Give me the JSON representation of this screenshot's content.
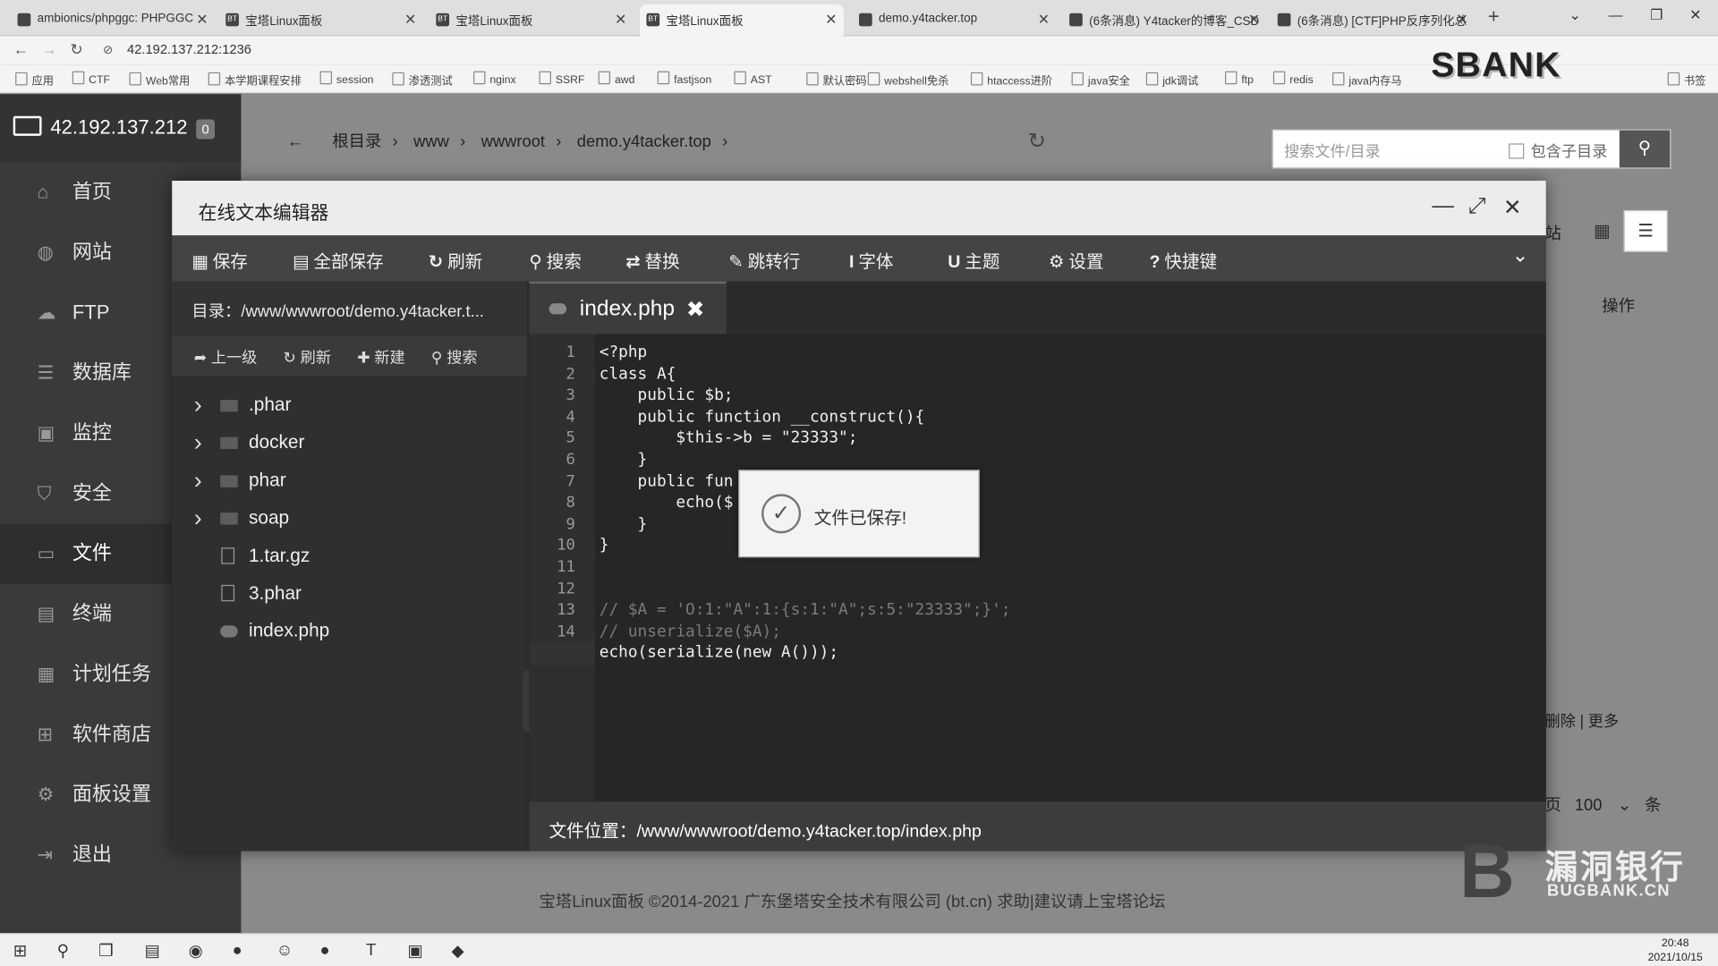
{
  "browser": {
    "tabs": [
      {
        "label": "ambionics/phpggc: PHPGGC",
        "favicon": "github-icon"
      },
      {
        "label": "宝塔Linux面板",
        "favicon": "bt-icon"
      },
      {
        "label": "宝塔Linux面板",
        "favicon": "bt-icon"
      },
      {
        "label": "宝塔Linux面板",
        "favicon": "bt-icon"
      },
      {
        "label": "demo.y4tacker.top",
        "favicon": "globe-icon"
      },
      {
        "label": "(6条消息) Y4tacker的博客_CSD",
        "favicon": "csdn-icon"
      },
      {
        "label": "(6条消息) [CTF]PHP反序列化总",
        "favicon": "csdn-icon"
      }
    ],
    "url": "42.192.137.212:1236",
    "bookmarks": [
      "应用",
      "CTF",
      "Web常用",
      "本学期课程安排",
      "session",
      "渗透测试",
      "nginx",
      "SSRF",
      "awd",
      "fastjson",
      "AST",
      "默认密码",
      "webshell免杀",
      "htaccess进阶",
      "java安全",
      "jdk调试",
      "ftp",
      "redis",
      "java内存马",
      "书签"
    ]
  },
  "overlay_logo": "SBANK",
  "sidebar": {
    "host": "42.192.137.212",
    "badge": "0",
    "items": [
      {
        "label": "首页",
        "icon": "home-icon"
      },
      {
        "label": "网站",
        "icon": "globe-icon"
      },
      {
        "label": "FTP",
        "icon": "ftp-icon"
      },
      {
        "label": "数据库",
        "icon": "database-icon"
      },
      {
        "label": "监控",
        "icon": "monitor-icon"
      },
      {
        "label": "安全",
        "icon": "shield-icon"
      },
      {
        "label": "文件",
        "icon": "folder-icon"
      },
      {
        "label": "终端",
        "icon": "terminal-icon"
      },
      {
        "label": "计划任务",
        "icon": "calendar-icon"
      },
      {
        "label": "软件商店",
        "icon": "grid-icon"
      },
      {
        "label": "面板设置",
        "icon": "gear-icon"
      },
      {
        "label": "退出",
        "icon": "logout-icon"
      }
    ],
    "active_index": 6
  },
  "files_panel": {
    "breadcrumb": [
      "根目录",
      "www",
      "wwwroot",
      "demo.y4tacker.top"
    ],
    "search_placeholder": "搜索文件/目录",
    "include_subdir": "包含子目录",
    "ops_header": "操作",
    "row_actions": "删除 | 更多",
    "page_size": "100",
    "page_unit": "条",
    "page_prefix": "页",
    "partial_label": "站"
  },
  "editor": {
    "title": "在线文本编辑器",
    "toolbar": [
      {
        "label": "保存",
        "icon": "save-icon",
        "glyph": "▦"
      },
      {
        "label": "全部保存",
        "icon": "save-all-icon",
        "glyph": "▤"
      },
      {
        "label": "刷新",
        "icon": "refresh-icon",
        "glyph": "↻"
      },
      {
        "label": "搜索",
        "icon": "search-icon",
        "glyph": "⚲"
      },
      {
        "label": "替换",
        "icon": "replace-icon",
        "glyph": "⇄"
      },
      {
        "label": "跳转行",
        "icon": "pin-icon",
        "glyph": "✎"
      },
      {
        "label": "字体",
        "icon": "font-icon",
        "glyph": "I"
      },
      {
        "label": "主题",
        "icon": "magnet-icon",
        "glyph": "U"
      },
      {
        "label": "设置",
        "icon": "gear-icon",
        "glyph": "⚙"
      },
      {
        "label": "快捷键",
        "icon": "help-icon",
        "glyph": "?"
      }
    ],
    "dir_label": "目录：/www/wwwroot/demo.y4tacker.t...",
    "tree_actions": [
      "上一级",
      "刷新",
      "新建",
      "搜索"
    ],
    "tree": [
      {
        "name": ".phar",
        "type": "folder"
      },
      {
        "name": "docker",
        "type": "folder"
      },
      {
        "name": "phar",
        "type": "folder"
      },
      {
        "name": "soap",
        "type": "folder"
      },
      {
        "name": "1.tar.gz",
        "type": "file"
      },
      {
        "name": "3.phar",
        "type": "file"
      },
      {
        "name": "index.php",
        "type": "php"
      }
    ],
    "open_file": "index.php",
    "code_lines": [
      "<?php",
      "class A{",
      "    public $b;",
      "    public function __construct(){",
      "        $this->b = \"23333\";",
      "    }",
      "    public fun",
      "        echo($",
      "    }",
      "}",
      "",
      "",
      "// $A = 'O:1:\"A\":1:{s:1:\"A\";s:5:\"23333\";}';",
      "// unserialize($A);",
      "echo(serialize(new A()));"
    ],
    "current_line": 15,
    "status_label": "文件位置：",
    "status_path": "/www/wwwroot/demo.y4tacker.top/index.php"
  },
  "toast": {
    "message": "文件已保存!"
  },
  "footer": "宝塔Linux面板 ©2014-2021 广东堡塔安全技术有限公司 (bt.cn)   求助|建议请上宝塔论坛",
  "watermark": {
    "big": "漏洞银行",
    "small": "BUGBANK.CN"
  },
  "taskbar": {
    "time": "20:48",
    "date": "2021/10/15"
  }
}
